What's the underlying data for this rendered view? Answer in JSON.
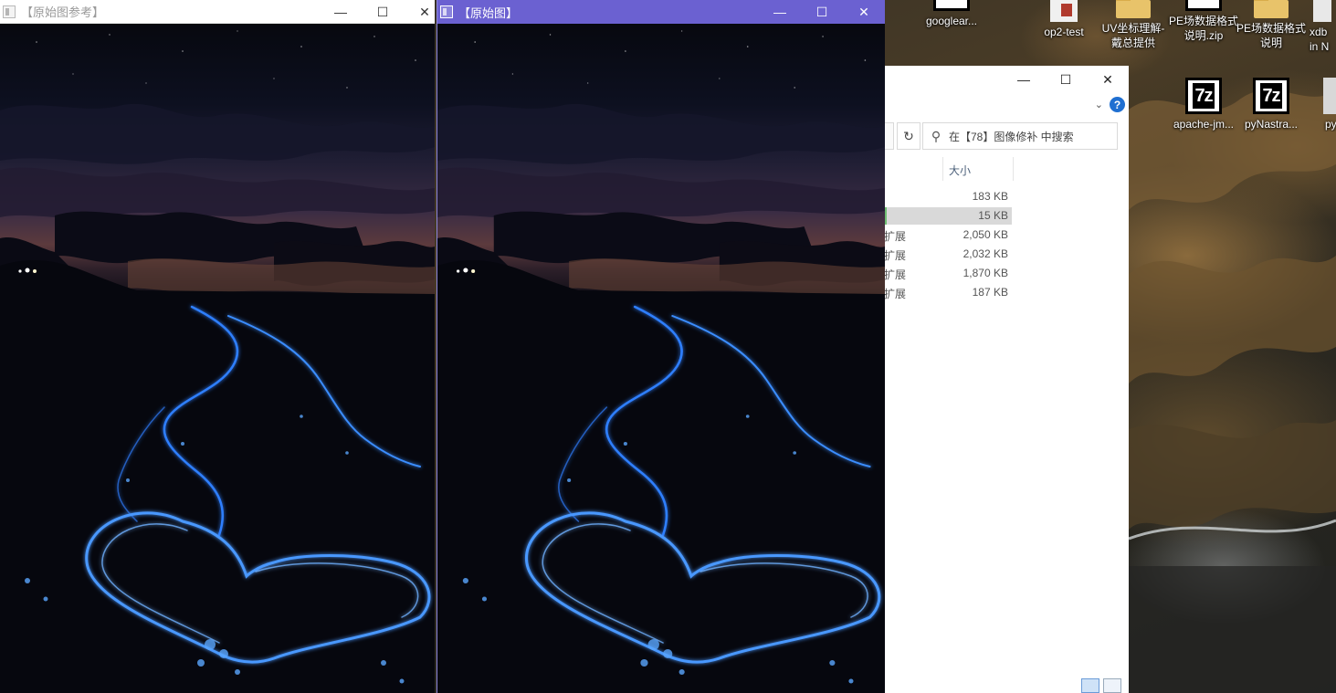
{
  "window_a": {
    "title": "【原始图参考】",
    "buttons": {
      "minimize": "—",
      "maximize": "☐",
      "close": "✕"
    }
  },
  "window_b": {
    "title": "【原始图】",
    "buttons": {
      "minimize": "—",
      "maximize": "☐",
      "close": "✕"
    }
  },
  "explorer": {
    "buttons": {
      "minimize": "—",
      "maximize": "☐",
      "close": "✕"
    },
    "help": "?",
    "chevron": "⌄",
    "refresh": "↻",
    "search_placeholder": "在【78】图像修补 中搜索",
    "column_size": "大小",
    "rows": [
      {
        "type": "",
        "size": "183 KB",
        "selected": false
      },
      {
        "type": "",
        "size": "15 KB",
        "selected": true
      },
      {
        "type": "扩展",
        "size": "2,050 KB",
        "selected": false
      },
      {
        "type": "扩展",
        "size": "2,032 KB",
        "selected": false
      },
      {
        "type": "扩展",
        "size": "1,870 KB",
        "selected": false
      },
      {
        "type": "扩展",
        "size": "187 KB",
        "selected": false
      }
    ]
  },
  "desktop_icons": [
    {
      "label": "googlear...",
      "icon": "app-icon"
    },
    {
      "label": "op2-test",
      "icon": "file-icon"
    },
    {
      "label": "UV坐标理解-戴总提供",
      "icon": "folder-icon"
    },
    {
      "label": "PE场数据格式说明.zip",
      "icon": "archive-icon"
    },
    {
      "label": "PE场数据格式说明",
      "icon": "folder-icon"
    },
    {
      "label": "xdb in N",
      "icon": "file-icon"
    },
    {
      "label": "apache-jm...",
      "icon": "7z-icon"
    },
    {
      "label": "pyNastra...",
      "icon": "7z-icon"
    },
    {
      "label": "py",
      "icon": "file-icon"
    }
  ],
  "colors": {
    "active_titlebar": "#6b61d1",
    "inactive_titlebar": "#ffffff",
    "glow": "#3a8dff"
  }
}
